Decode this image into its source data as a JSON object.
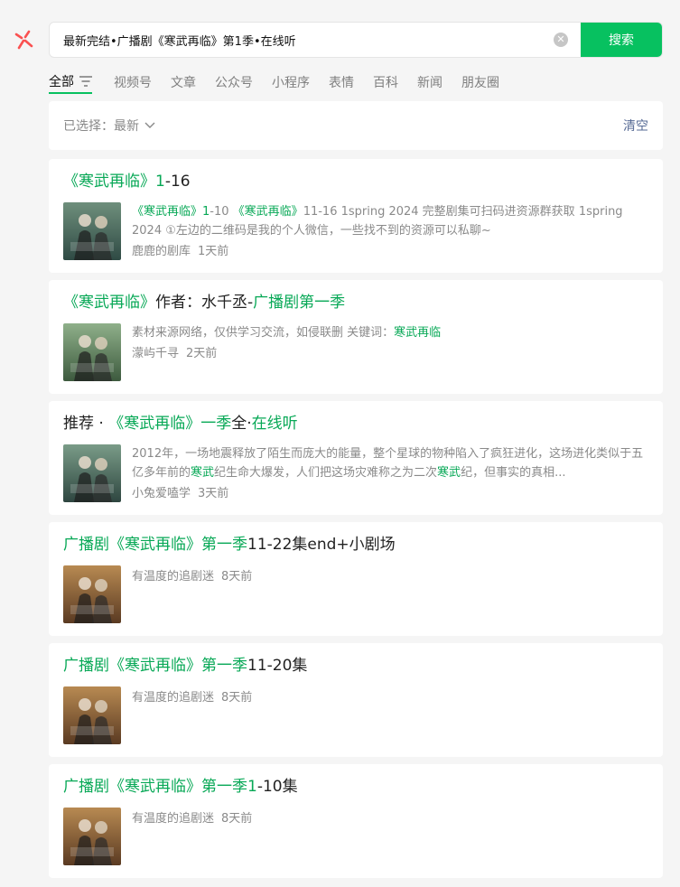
{
  "search": {
    "value": "最新完结•广播剧《寒武再临》第1季•在线听",
    "clear_icon": "close-circle-icon",
    "button_label": "搜索"
  },
  "tabs": [
    {
      "label": "全部",
      "active": true
    },
    {
      "label": "视频号"
    },
    {
      "label": "文章"
    },
    {
      "label": "公众号"
    },
    {
      "label": "小程序"
    },
    {
      "label": "表情"
    },
    {
      "label": "百科"
    },
    {
      "label": "新闻"
    },
    {
      "label": "朋友圈"
    }
  ],
  "filter": {
    "selected_label": "已选择：",
    "selected_value": "最新",
    "clear_label": "清空"
  },
  "colors": {
    "accent": "#07c160",
    "highlight": "#07a856",
    "link": "#576b95"
  },
  "results": [
    {
      "title_parts": [
        {
          "t": "《寒武再临》",
          "h": true
        },
        {
          "t": "1",
          "h": true
        },
        {
          "t": "-16",
          "h": false
        }
      ],
      "desc_parts": [
        {
          "t": "《寒武再临》",
          "h": true
        },
        {
          "t": "1",
          "h": true
        },
        {
          "t": "-10 ",
          "h": false
        },
        {
          "t": "《寒武再临》",
          "h": true
        },
        {
          "t": "11-16 1spring 2024 完整剧集可扫码进资源群获取 1spring 2024 ①左边的二维码是我的个人微信，一些找不到的资源可以私聊~",
          "h": false
        }
      ],
      "source": "鹿鹿的剧库",
      "time": "1天前"
    },
    {
      "title_parts": [
        {
          "t": "《寒武再临》",
          "h": true
        },
        {
          "t": "作者：水千丞-",
          "h": false
        },
        {
          "t": "广播剧第一季",
          "h": true
        }
      ],
      "desc_parts": [
        {
          "t": "素材来源网络，仅供学习交流，如侵联删 关键词：",
          "h": false
        },
        {
          "t": "寒武再临",
          "h": true
        }
      ],
      "source": "濛屿千寻",
      "time": "2天前"
    },
    {
      "title_parts": [
        {
          "t": "推荐 · ",
          "h": false
        },
        {
          "t": "《寒武再临》一季",
          "h": true
        },
        {
          "t": "全·",
          "h": false
        },
        {
          "t": "在线听",
          "h": true
        }
      ],
      "desc_parts": [
        {
          "t": "2012年，一场地震释放了陌生而庞大的能量，整个星球的物种陷入了疯狂进化，这场进化类似于五亿多年前的",
          "h": false
        },
        {
          "t": "寒武",
          "h": true
        },
        {
          "t": "纪生命大爆发，人们把这场灾难称之为二次",
          "h": false
        },
        {
          "t": "寒武",
          "h": true
        },
        {
          "t": "纪，但事实的真相...",
          "h": false
        }
      ],
      "source": "小兔爱嗑学",
      "time": "3天前"
    },
    {
      "title_parts": [
        {
          "t": "广播剧《寒武再临》第一季",
          "h": true
        },
        {
          "t": "11-22集end+小剧场",
          "h": false
        }
      ],
      "desc_parts": [],
      "source": "有温度的追剧迷",
      "time": "8天前"
    },
    {
      "title_parts": [
        {
          "t": "广播剧《寒武再临》第一季",
          "h": true
        },
        {
          "t": "11-20集",
          "h": false
        }
      ],
      "desc_parts": [],
      "source": "有温度的追剧迷",
      "time": "8天前"
    },
    {
      "title_parts": [
        {
          "t": "广播剧《寒武再临》第一季",
          "h": true
        },
        {
          "t": "1",
          "h": true
        },
        {
          "t": "-10集",
          "h": false
        }
      ],
      "desc_parts": [],
      "source": "有温度的追剧迷",
      "time": "8天前"
    }
  ]
}
